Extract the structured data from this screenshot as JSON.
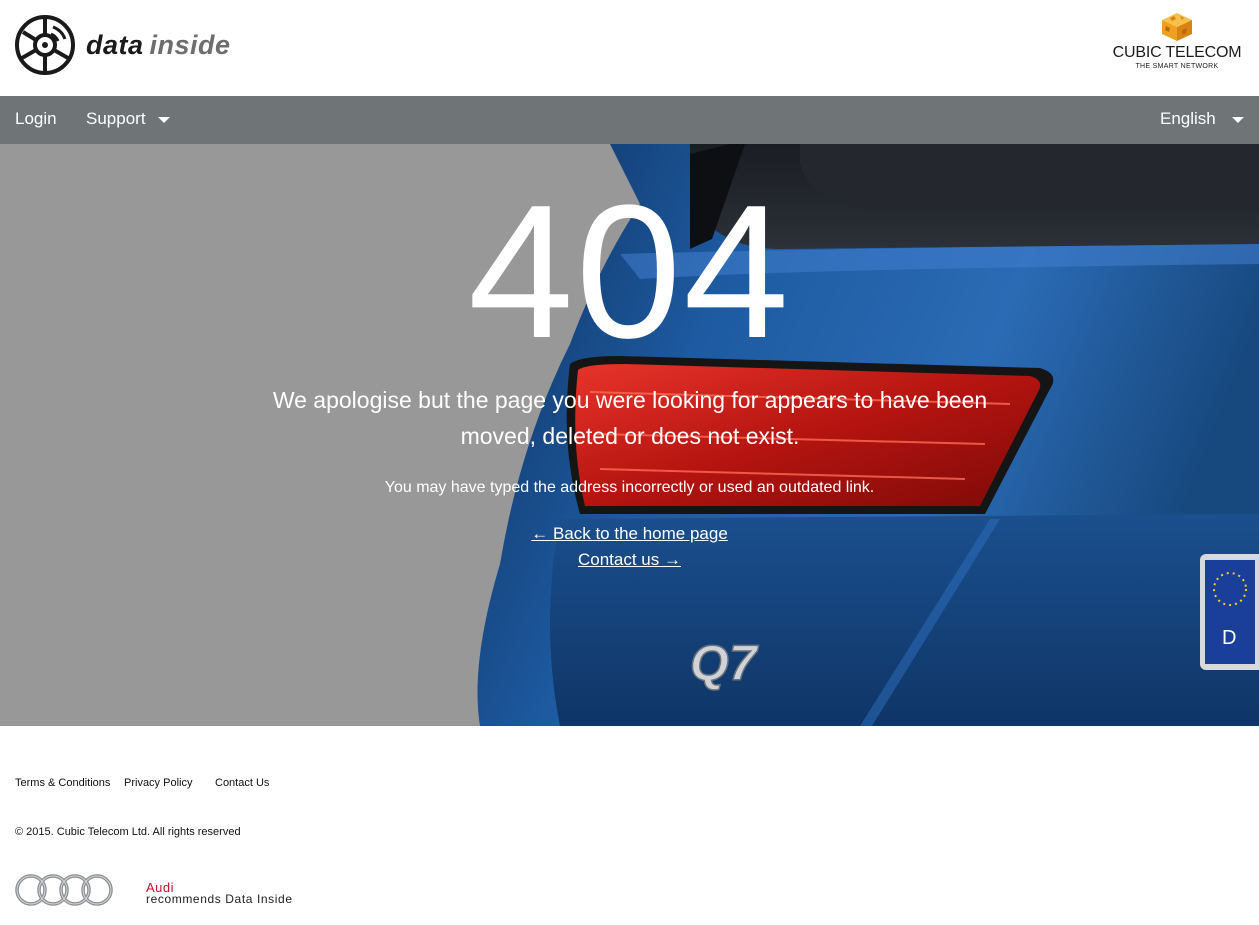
{
  "header": {
    "logo": {
      "word1": "data",
      "word2": "inside"
    },
    "partner": {
      "name": "CUBIC TELECOM",
      "tagline": "THE SMART NETWORK"
    }
  },
  "nav": {
    "login": "Login",
    "support": "Support",
    "language": "English"
  },
  "error": {
    "code": "404",
    "message": "We apologise but the page you were looking for appears to have been moved, deleted or does not exist.",
    "sub": "You may have typed the address incorrectly or used an outdated link.",
    "back_link": "← Back to the home page",
    "contact_link": "Contact us →"
  },
  "car": {
    "badge": "Q7",
    "plate_letter": "D"
  },
  "footer": {
    "terms": "Terms & Conditions",
    "privacy": "Privacy Policy",
    "contact": "Contact Us",
    "copyright": "© 2015. Cubic Telecom Ltd. All rights reserved",
    "audi_brand": "Audi",
    "audi_tagline": "recommends Data Inside"
  },
  "colors": {
    "nav_bg": "#6f7577",
    "hero_gray": "#989898",
    "car_blue": "#1d5aa0",
    "audi_red": "#c8102e",
    "partner_orange": "#f0a020"
  }
}
